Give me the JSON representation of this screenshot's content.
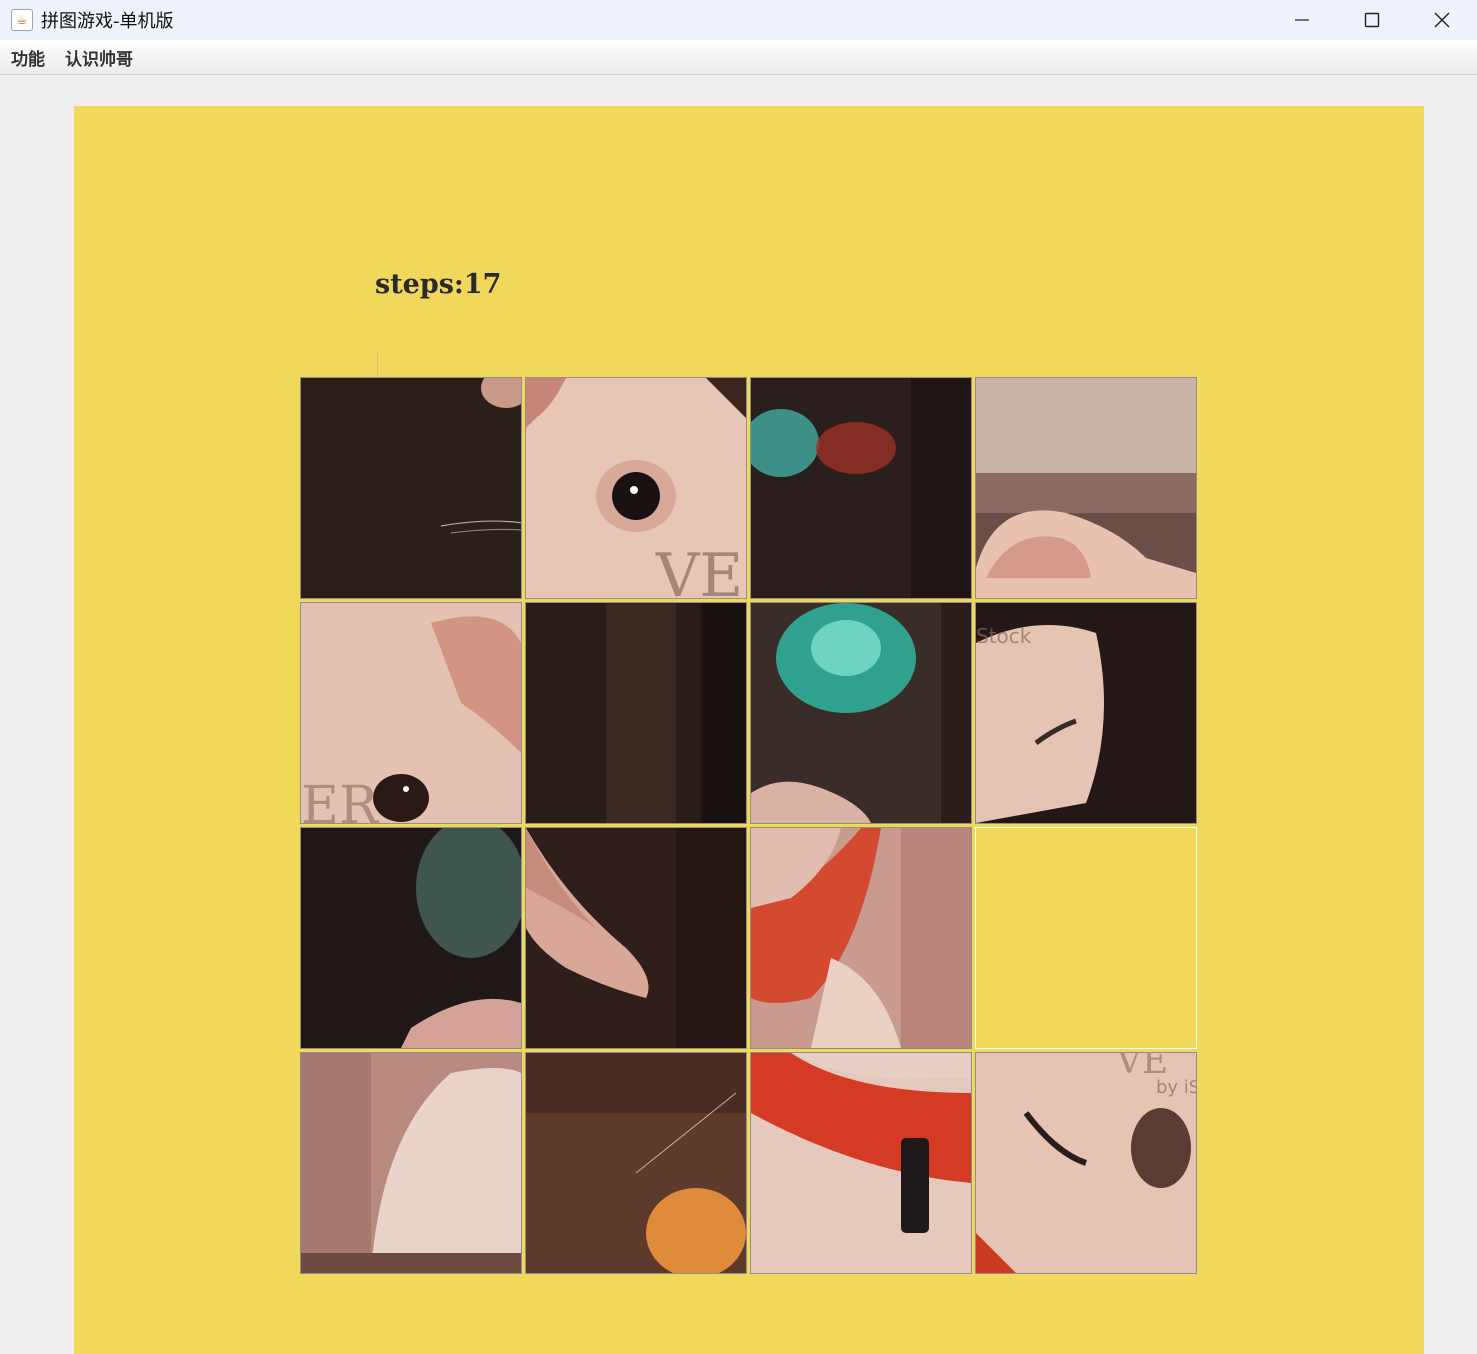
{
  "window": {
    "title": "拼图游戏-单机版",
    "icon": "java-icon",
    "controls": [
      "minimize-icon",
      "maximize-icon",
      "close-icon"
    ]
  },
  "menu": {
    "items": [
      "功能",
      "认识帅哥"
    ]
  },
  "game": {
    "steps_text": "steps:17",
    "background_color": "#f1d75a",
    "grid_size": 4,
    "blank_position": {
      "row": 2,
      "col": 3
    },
    "tiles": [
      {
        "row": 0,
        "col": 0,
        "content": "dark background with whisker and ear tip"
      },
      {
        "row": 0,
        "col": 1,
        "content": "dog eye close-up",
        "watermark": "VE"
      },
      {
        "row": 0,
        "col": 2,
        "content": "blurred teal and red lights"
      },
      {
        "row": 0,
        "col": 3,
        "content": "dog ear on blurred background"
      },
      {
        "row": 1,
        "col": 0,
        "content": "dog eye and ear",
        "watermark": "ER"
      },
      {
        "row": 1,
        "col": 1,
        "content": "dark brown background"
      },
      {
        "row": 1,
        "col": 2,
        "content": "teal blur with ear edge"
      },
      {
        "row": 1,
        "col": 3,
        "content": "dog face side",
        "watermark": "Stock"
      },
      {
        "row": 2,
        "col": 0,
        "content": "dark background with teal glow and ear"
      },
      {
        "row": 2,
        "col": 1,
        "content": "dog ear on dark background"
      },
      {
        "row": 2,
        "col": 2,
        "content": "dog neck with red collar"
      },
      {
        "row": 3,
        "col": 0,
        "content": "dog body pink blur"
      },
      {
        "row": 3,
        "col": 1,
        "content": "brown background with orange object"
      },
      {
        "row": 3,
        "col": 2,
        "content": "red collar with black tag"
      },
      {
        "row": 3,
        "col": 3,
        "content": "dog snout smiling",
        "watermark": "by iS"
      }
    ]
  }
}
